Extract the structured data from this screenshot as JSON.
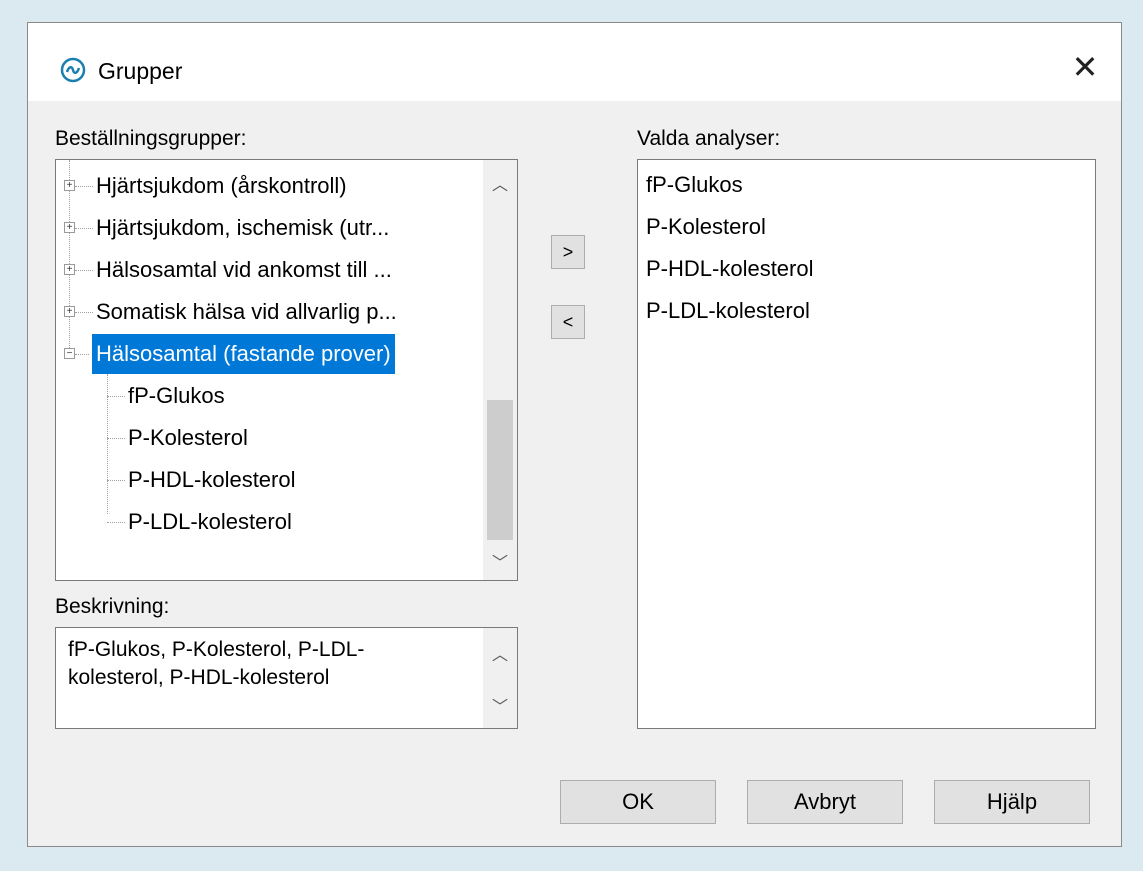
{
  "window": {
    "title": "Grupper",
    "close_glyph": "✕"
  },
  "left_panel": {
    "label": "Beställningsgrupper:",
    "tree": [
      {
        "label": "Hjärtsjukdom (årskontroll)",
        "expander": "+"
      },
      {
        "label": "Hjärtsjukdom, ischemisk (utr...",
        "expander": "+"
      },
      {
        "label": "Hälsosamtal vid ankomst till ...",
        "expander": "+"
      },
      {
        "label": "Somatisk hälsa vid allvarlig p...",
        "expander": "+"
      },
      {
        "label": "Hälsosamtal (fastande prover)",
        "expander": "−",
        "selected": true
      },
      {
        "label": "fP-Glukos"
      },
      {
        "label": "P-Kolesterol"
      },
      {
        "label": "P-HDL-kolesterol"
      },
      {
        "label": "P-LDL-kolesterol"
      }
    ],
    "scroll_up_glyph": "︿",
    "scroll_down_glyph": "﹀"
  },
  "transfer_buttons": {
    "add": ">",
    "remove": "<"
  },
  "right_panel": {
    "label": "Valda analyser:",
    "items": [
      "fP-Glukos",
      "P-Kolesterol",
      "P-HDL-kolesterol",
      "P-LDL-kolesterol"
    ]
  },
  "description": {
    "label": "Beskrivning:",
    "text": "fP-Glukos, P-Kolesterol, P-LDL-kolesterol, P-HDL-kolesterol"
  },
  "buttons": {
    "ok": "OK",
    "cancel": "Avbryt",
    "help": "Hjälp"
  },
  "colors": {
    "selection": "#0078d7",
    "background": "#dbeaf0",
    "dialog": "#f0f0f0"
  },
  "icons": {
    "app": "app-logo-icon",
    "close": "close-icon"
  }
}
